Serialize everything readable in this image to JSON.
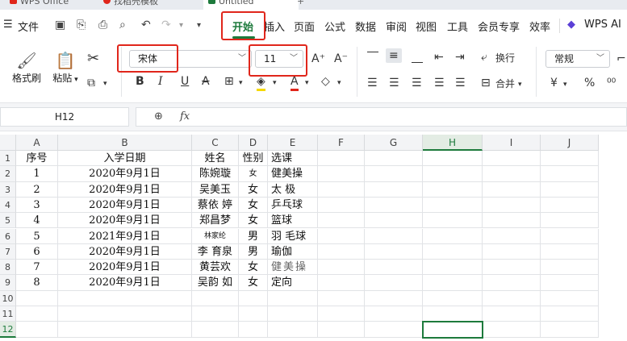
{
  "tabs": [
    {
      "label": "WPS Office",
      "active": false,
      "color": "#e0261b"
    },
    {
      "label": "找稻壳模板",
      "active": false,
      "color": "#e0261b"
    },
    {
      "label": "Untitled",
      "active": true,
      "color": "#1d7a3c"
    }
  ],
  "menu": {
    "file": "文件",
    "items": [
      "开始",
      "插入",
      "页面",
      "公式",
      "数据",
      "审阅",
      "视图",
      "工具",
      "会员专享",
      "效率"
    ],
    "wps_ai": "WPS AI"
  },
  "ribbon": {
    "format_painter": "格式刷",
    "paste": "粘贴",
    "font_name": "宋体",
    "font_size": "11",
    "wrap": "换行",
    "merge": "合并",
    "number_format": "常规"
  },
  "formula_bar": {
    "name_box": "H12",
    "fx": "fx",
    "value": ""
  },
  "sheet": {
    "columns": [
      "A",
      "B",
      "C",
      "D",
      "E",
      "F",
      "G",
      "H",
      "I",
      "J"
    ],
    "selected_column": "H",
    "selected_row": "12",
    "rows": [
      {
        "num": "1",
        "cells": [
          "序号",
          "入学日期",
          "姓名",
          "性别",
          "选课"
        ]
      },
      {
        "num": "2",
        "cells": [
          "1",
          "2020年9月1日",
          "陈婉璇",
          "女",
          "健美操"
        ]
      },
      {
        "num": "3",
        "cells": [
          "2",
          "2020年9月1日",
          "吴美玉",
          "女",
          "太 极"
        ]
      },
      {
        "num": "4",
        "cells": [
          "3",
          "2020年9月1日",
          "蔡依 婷",
          "女",
          "乒乓球"
        ]
      },
      {
        "num": "5",
        "cells": [
          "4",
          "2020年9月1日",
          "郑昌梦",
          "女",
          "篮球"
        ]
      },
      {
        "num": "6",
        "cells": [
          "5",
          "2021年9月1日",
          "林家纶",
          "男",
          "羽 毛球"
        ]
      },
      {
        "num": "7",
        "cells": [
          "6",
          "2020年9月1日",
          "李 育泉",
          "男",
          "瑜伽"
        ]
      },
      {
        "num": "8",
        "cells": [
          "7",
          "2020年9月1日",
          "黄芸欢",
          "女",
          "健美操"
        ]
      },
      {
        "num": "9",
        "cells": [
          "8",
          "2020年9月1日",
          "吴韵 如",
          "女",
          "定向"
        ]
      },
      {
        "num": "10",
        "cells": [
          "",
          "",
          "",
          "",
          ""
        ]
      },
      {
        "num": "11",
        "cells": [
          "",
          "",
          "",
          "",
          ""
        ]
      },
      {
        "num": "12",
        "cells": [
          "",
          "",
          "",
          "",
          ""
        ]
      }
    ]
  },
  "colors": {
    "accent_green": "#1d7a3c",
    "highlight_red": "#e0261b",
    "active_tab": "#1d7a3c"
  }
}
